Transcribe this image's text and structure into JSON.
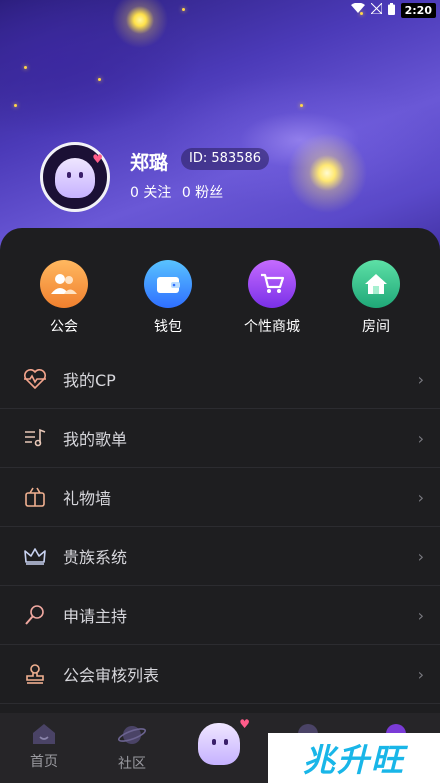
{
  "status_bar": {
    "time": "2:20"
  },
  "profile": {
    "name": "郑璐",
    "id_label": "ID: 583586",
    "follow_text": "0 关注",
    "fans_text": "0 粉丝"
  },
  "quick_actions": [
    {
      "label": "公会",
      "icon": "guild-icon",
      "color": "#f39a45"
    },
    {
      "label": "钱包",
      "icon": "wallet-icon",
      "color": "#3fa6ff"
    },
    {
      "label": "个性商城",
      "icon": "cart-icon",
      "color": "#9b4dff"
    },
    {
      "label": "房间",
      "icon": "home-icon",
      "color": "#36c98e"
    }
  ],
  "menu": [
    {
      "label": "我的CP",
      "icon": "heart-pulse-icon"
    },
    {
      "label": "我的歌单",
      "icon": "playlist-icon"
    },
    {
      "label": "礼物墙",
      "icon": "gift-icon"
    },
    {
      "label": "贵族系统",
      "icon": "crown-icon"
    },
    {
      "label": "申请主持",
      "icon": "microphone-icon"
    },
    {
      "label": "公会审核列表",
      "icon": "stamp-icon"
    }
  ],
  "tabbar": {
    "home": "首页",
    "community": "社区"
  },
  "watermark": "兆升旺"
}
